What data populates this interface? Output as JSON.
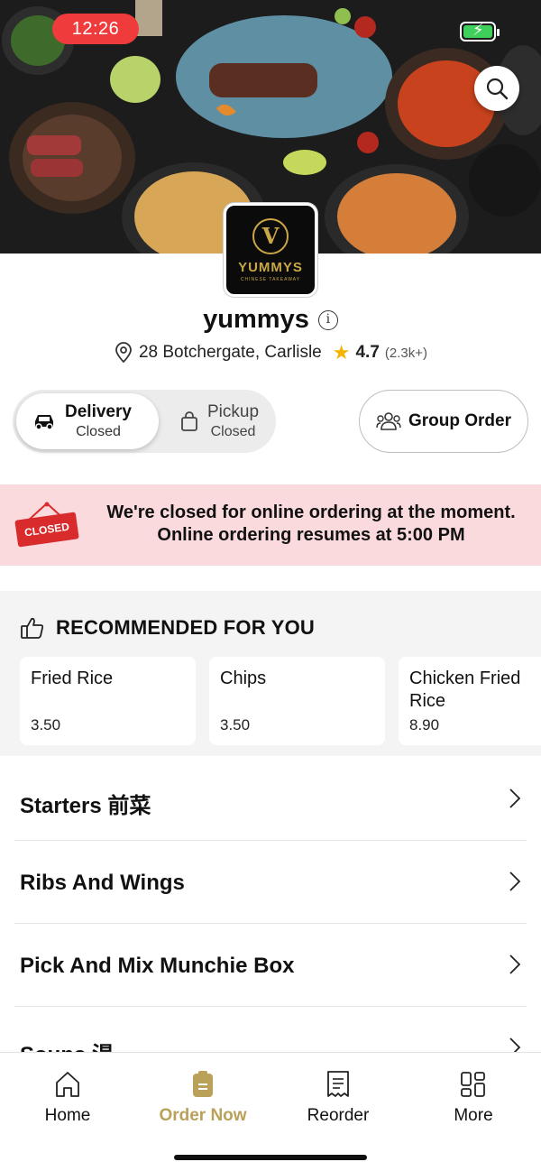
{
  "status": {
    "time": "12:26"
  },
  "restaurant": {
    "logo_word": "YUMMYS",
    "logo_sub": "CHINESE TAKEAWAY",
    "name": "yummys",
    "address": "28 Botchergate, Carlisle",
    "rating": "4.7",
    "rating_count": "(2.3k+)"
  },
  "mode_toggle": {
    "delivery": {
      "label": "Delivery",
      "status": "Closed"
    },
    "pickup": {
      "label": "Pickup",
      "status": "Closed"
    }
  },
  "group_order": {
    "label": "Group Order"
  },
  "closed_banner": {
    "sign_text": "CLOSED",
    "line1": "We're closed for online ordering at the moment.",
    "line2": "Online ordering resumes at 5:00 PM"
  },
  "recommended": {
    "title": "RECOMMENDED FOR YOU",
    "items": [
      {
        "name": "Fried Rice",
        "price": "3.50"
      },
      {
        "name": "Chips",
        "price": "3.50"
      },
      {
        "name": "Chicken Fried Rice",
        "price": "8.90"
      }
    ]
  },
  "categories": [
    {
      "label": "Starters 前菜"
    },
    {
      "label": "Ribs And Wings"
    },
    {
      "label": "Pick And Mix Munchie Box"
    },
    {
      "label": "Soups 湯"
    }
  ],
  "nav": {
    "home": "Home",
    "order_now": "Order Now",
    "reorder": "Reorder",
    "more": "More"
  },
  "colors": {
    "accent": "#b9a15a",
    "closed_banner_bg": "#fadadd",
    "closed_sign": "#d92b2b",
    "star": "#f5b400"
  }
}
